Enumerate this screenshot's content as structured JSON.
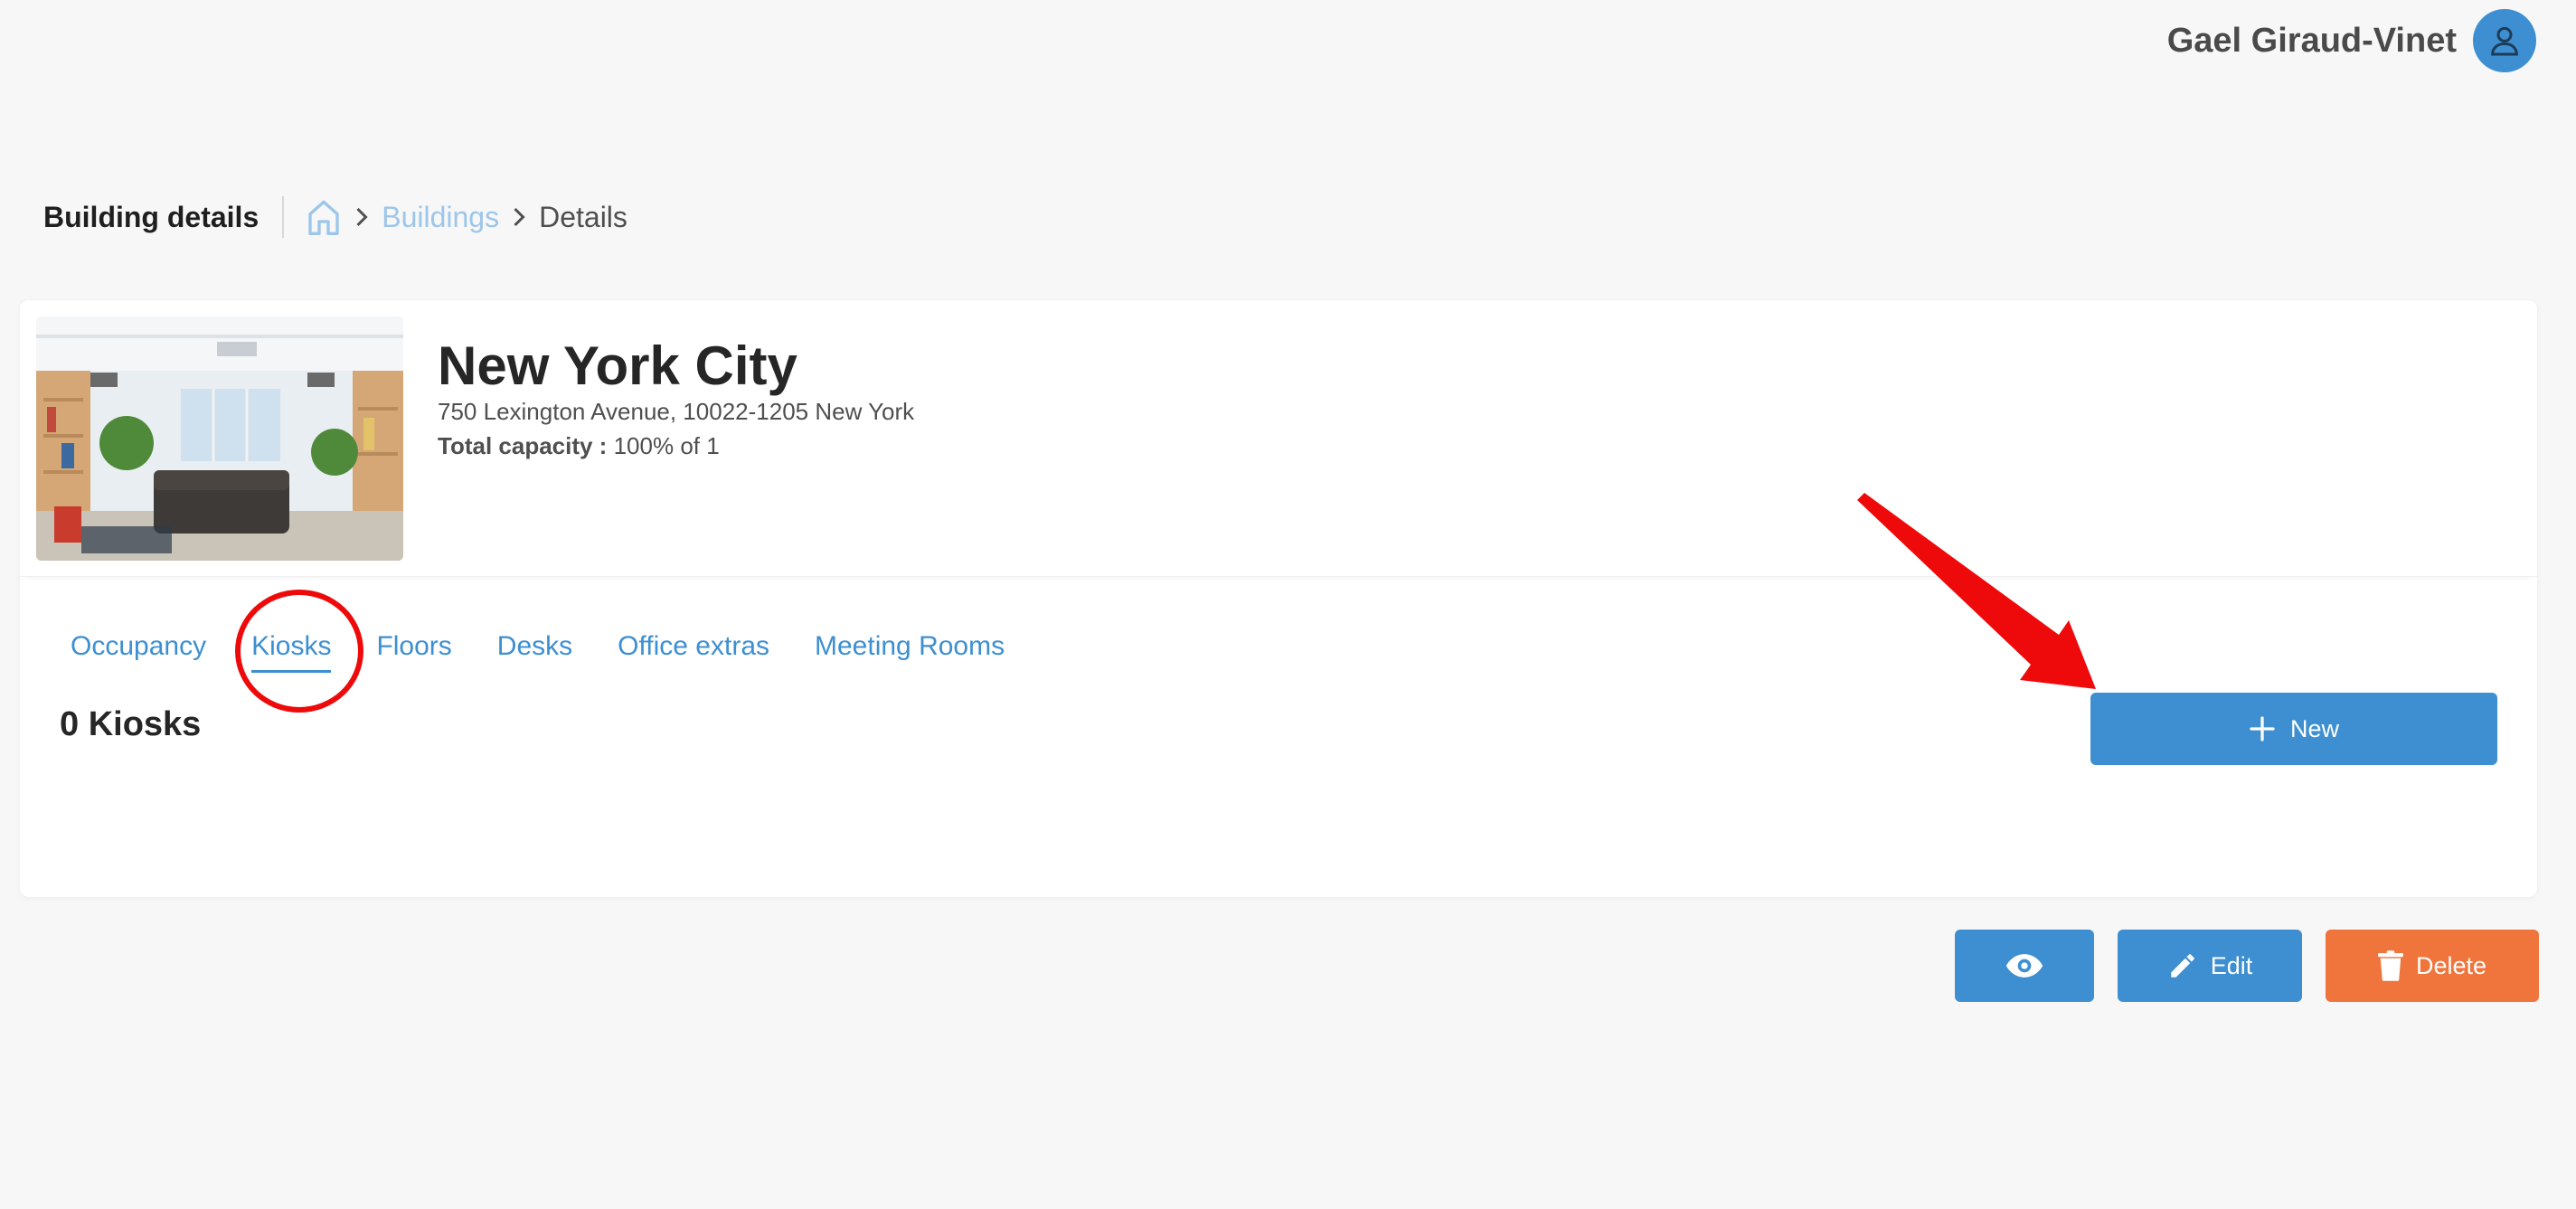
{
  "user": {
    "name": "Gael Giraud-Vinet",
    "avatar_icon": "user-icon"
  },
  "header": {
    "title": "Building details",
    "breadcrumb": {
      "home_icon": "home-icon",
      "items": [
        {
          "label": "Buildings",
          "link": true
        },
        {
          "label": "Details",
          "link": false
        }
      ]
    }
  },
  "building": {
    "name": "New York City",
    "address": "750 Lexington Avenue, 10022-1205 New York",
    "capacity_label": "Total capacity :",
    "capacity_value": "100% of 1"
  },
  "tabs": [
    {
      "label": "Occupancy",
      "active": false
    },
    {
      "label": "Kiosks",
      "active": true
    },
    {
      "label": "Floors",
      "active": false
    },
    {
      "label": "Desks",
      "active": false
    },
    {
      "label": "Office extras",
      "active": false
    },
    {
      "label": "Meeting Rooms",
      "active": false
    }
  ],
  "kiosks": {
    "count_label": "0 Kiosks",
    "new_button_label": "New"
  },
  "actions": {
    "view_icon": "eye-icon",
    "edit_label": "Edit",
    "delete_label": "Delete"
  },
  "colors": {
    "primary": "#3d8fd1",
    "danger": "#f0753c",
    "annotation": "#ee0a0a",
    "background": "#f7f7f7"
  }
}
